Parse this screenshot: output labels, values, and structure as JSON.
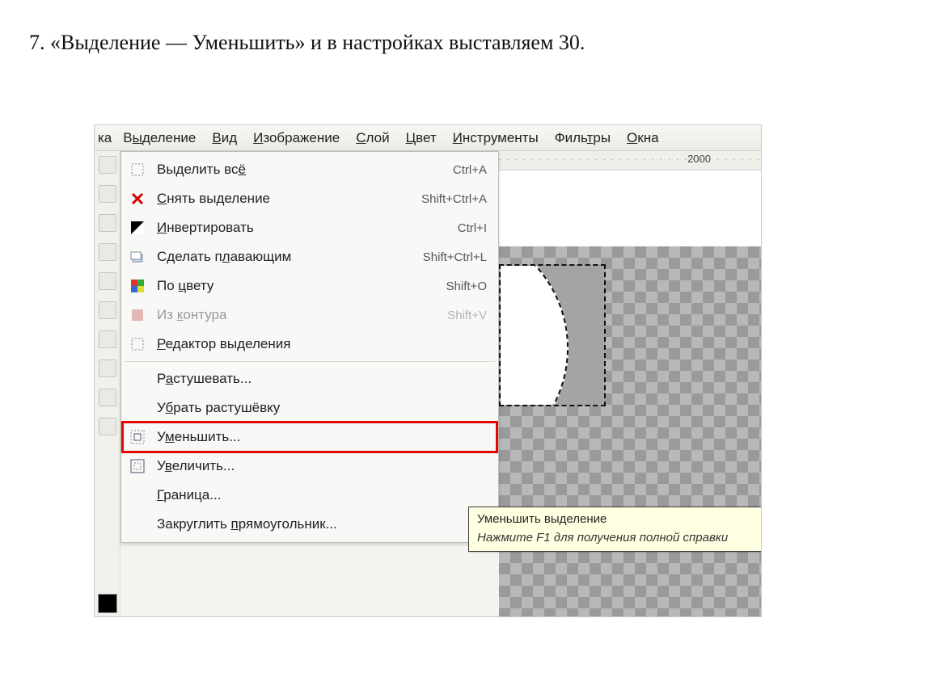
{
  "caption": "7. «Выделение — Уменьшить» и в настройках выставляем 30.",
  "menubar": {
    "fragment": "ка",
    "items": [
      {
        "pre": "В",
        "ul": "ы",
        "post": "деление"
      },
      {
        "pre": "",
        "ul": "В",
        "post": "ид"
      },
      {
        "pre": "",
        "ul": "И",
        "post": "зображение"
      },
      {
        "pre": "",
        "ul": "С",
        "post": "лой"
      },
      {
        "pre": "",
        "ul": "Ц",
        "post": "вет"
      },
      {
        "pre": "",
        "ul": "И",
        "post": "нструменты"
      },
      {
        "pre": "Филь",
        "ul": "т",
        "post": "ры"
      },
      {
        "pre": "",
        "ul": "О",
        "post": "кна"
      }
    ]
  },
  "ruler": {
    "tick": "2000"
  },
  "menu": {
    "items": [
      {
        "icon": "select-all-icon",
        "pre": "Выделить вс",
        "ul": "ё",
        "post": "",
        "shortcut": "Ctrl+A",
        "disabled": false
      },
      {
        "icon": "cancel-icon",
        "pre": "",
        "ul": "С",
        "post": "нять выделение",
        "shortcut": "Shift+Ctrl+A",
        "disabled": false
      },
      {
        "icon": "invert-icon",
        "pre": "",
        "ul": "И",
        "post": "нвертировать",
        "shortcut": "Ctrl+I",
        "disabled": false
      },
      {
        "icon": "float-icon",
        "pre": "Сделать п",
        "ul": "л",
        "post": "авающим",
        "shortcut": "Shift+Ctrl+L",
        "disabled": false
      },
      {
        "icon": "by-color-icon",
        "pre": "По ",
        "ul": "ц",
        "post": "вету",
        "shortcut": "Shift+O",
        "disabled": false
      },
      {
        "icon": "from-path-icon",
        "pre": "Из ",
        "ul": "к",
        "post": "онтура",
        "shortcut": "Shift+V",
        "disabled": true
      },
      {
        "icon": "editor-icon",
        "pre": "",
        "ul": "Р",
        "post": "едактор выделения",
        "shortcut": "",
        "disabled": false
      }
    ],
    "items2": [
      {
        "icon": "",
        "pre": "Р",
        "ul": "а",
        "post": "стушевать...",
        "shortcut": "",
        "disabled": false
      },
      {
        "icon": "",
        "pre": "У",
        "ul": "б",
        "post": "рать растушёвку",
        "shortcut": "",
        "disabled": false
      },
      {
        "icon": "shrink-icon",
        "pre": "У",
        "ul": "м",
        "post": "еньшить...",
        "shortcut": "",
        "disabled": false,
        "highlight": true
      },
      {
        "icon": "grow-icon",
        "pre": "У",
        "ul": "в",
        "post": "еличить...",
        "shortcut": "",
        "disabled": false
      },
      {
        "icon": "",
        "pre": "",
        "ul": "Г",
        "post": "раница...",
        "shortcut": "",
        "disabled": false
      },
      {
        "icon": "",
        "pre": "Закруглить ",
        "ul": "п",
        "post": "рямоугольник...",
        "shortcut": "",
        "disabled": false
      }
    ]
  },
  "tooltip": {
    "title": "Уменьшить выделение",
    "body": "Нажмите F1 для получения полной справки"
  }
}
